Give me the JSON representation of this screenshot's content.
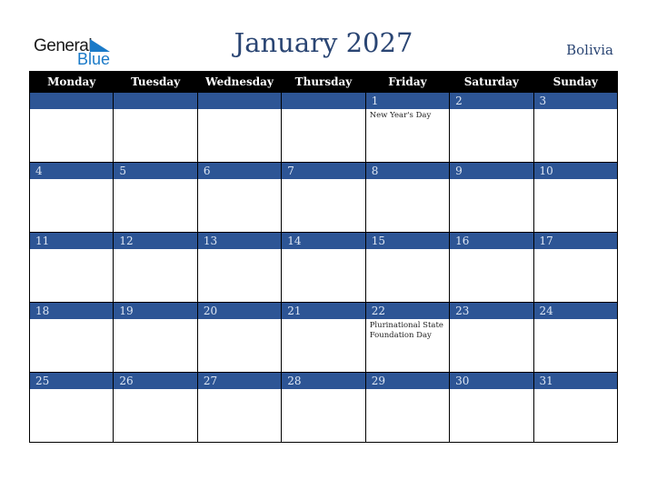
{
  "logo": {
    "line1": "General",
    "line2": "Blue",
    "icon": "triangle-flag-icon",
    "brand_color": "#1a7ac8"
  },
  "header": {
    "title": "January 2027",
    "country": "Bolivia"
  },
  "colors": {
    "header_bg": "#000000",
    "band_bg": "#2d5595",
    "title_color": "#2a4573"
  },
  "weekdays": [
    "Monday",
    "Tuesday",
    "Wednesday",
    "Thursday",
    "Friday",
    "Saturday",
    "Sunday"
  ],
  "weeks": [
    [
      {
        "day": "",
        "holiday": ""
      },
      {
        "day": "",
        "holiday": ""
      },
      {
        "day": "",
        "holiday": ""
      },
      {
        "day": "",
        "holiday": ""
      },
      {
        "day": "1",
        "holiday": "New Year's Day"
      },
      {
        "day": "2",
        "holiday": ""
      },
      {
        "day": "3",
        "holiday": ""
      }
    ],
    [
      {
        "day": "4",
        "holiday": ""
      },
      {
        "day": "5",
        "holiday": ""
      },
      {
        "day": "6",
        "holiday": ""
      },
      {
        "day": "7",
        "holiday": ""
      },
      {
        "day": "8",
        "holiday": ""
      },
      {
        "day": "9",
        "holiday": ""
      },
      {
        "day": "10",
        "holiday": ""
      }
    ],
    [
      {
        "day": "11",
        "holiday": ""
      },
      {
        "day": "12",
        "holiday": ""
      },
      {
        "day": "13",
        "holiday": ""
      },
      {
        "day": "14",
        "holiday": ""
      },
      {
        "day": "15",
        "holiday": ""
      },
      {
        "day": "16",
        "holiday": ""
      },
      {
        "day": "17",
        "holiday": ""
      }
    ],
    [
      {
        "day": "18",
        "holiday": ""
      },
      {
        "day": "19",
        "holiday": ""
      },
      {
        "day": "20",
        "holiday": ""
      },
      {
        "day": "21",
        "holiday": ""
      },
      {
        "day": "22",
        "holiday": "Plurinational State Foundation Day"
      },
      {
        "day": "23",
        "holiday": ""
      },
      {
        "day": "24",
        "holiday": ""
      }
    ],
    [
      {
        "day": "25",
        "holiday": ""
      },
      {
        "day": "26",
        "holiday": ""
      },
      {
        "day": "27",
        "holiday": ""
      },
      {
        "day": "28",
        "holiday": ""
      },
      {
        "day": "29",
        "holiday": ""
      },
      {
        "day": "30",
        "holiday": ""
      },
      {
        "day": "31",
        "holiday": ""
      }
    ]
  ]
}
